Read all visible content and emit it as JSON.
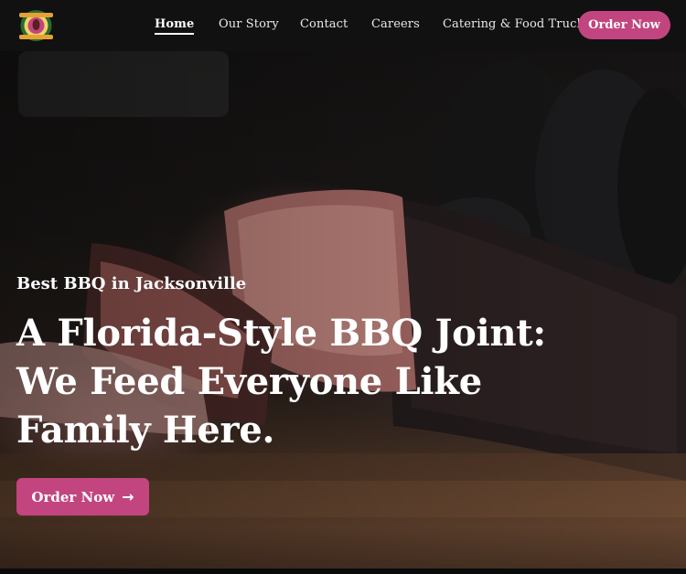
{
  "nav": {
    "logo_icon": "restaurant-logo",
    "links": [
      {
        "label": "Home",
        "active": true
      },
      {
        "label": "Our Story",
        "active": false
      },
      {
        "label": "Contact",
        "active": false
      },
      {
        "label": "Careers",
        "active": false
      },
      {
        "label": "Catering & Food Truck",
        "active": false
      }
    ],
    "order_button": "Order Now"
  },
  "hero": {
    "eyebrow": "Best BBQ in Jacksonville",
    "headline_lines": [
      "A Florida-Style BBQ Joint:",
      "We Feed Everyone Like",
      "Family Here."
    ],
    "cta_label": "Order Now",
    "cta_icon": "arrow-right-icon",
    "background_image": "smoked-brisket-photo"
  },
  "colors": {
    "accent": "#c2457f",
    "nav_bg": "#111111",
    "text": "#ffffff"
  }
}
